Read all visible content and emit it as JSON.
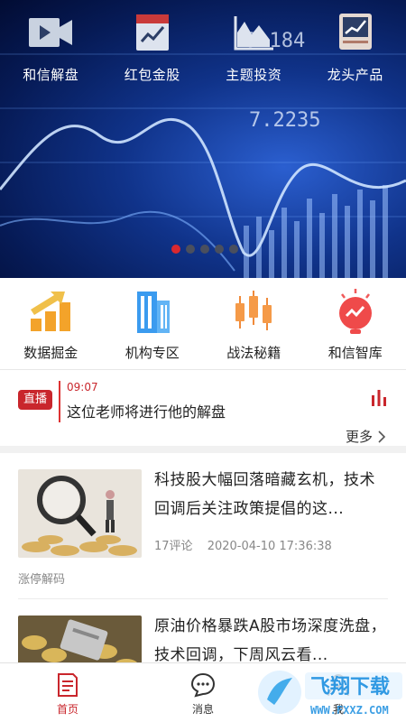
{
  "banner": {
    "quick_items": [
      {
        "label": "和信解盘",
        "icon": "video-icon"
      },
      {
        "label": "红包金股",
        "icon": "stock-chart-card-icon"
      },
      {
        "label": "主题投资",
        "icon": "area-chart-icon"
      },
      {
        "label": "龙头产品",
        "icon": "trend-board-icon"
      }
    ],
    "numbers": [
      "9.184",
      "7.2235"
    ],
    "carousel": {
      "count": 5,
      "active": 1
    }
  },
  "features": [
    {
      "label": "数据掘金",
      "icon": "bar-growth-icon"
    },
    {
      "label": "机构专区",
      "icon": "building-icon"
    },
    {
      "label": "战法秘籍",
      "icon": "candlestick-icon"
    },
    {
      "label": "和信智库",
      "icon": "bulb-chart-icon"
    }
  ],
  "live": {
    "tag": "直播",
    "time": "09:07",
    "text": "这位老师将进行他的解盘",
    "more_label": "更多"
  },
  "news": [
    {
      "title": "科技股大幅回落暗藏玄机，技术回调后关注政策提倡的这...",
      "comments": "17评论",
      "datetime": "2020-04-10 17:36:38",
      "tag": "涨停解码"
    },
    {
      "title": "原油价格暴跌A股市场深度洗盘，技术回调，下周风云看...",
      "comments": "",
      "datetime": "",
      "tag": ""
    }
  ],
  "tabbar": [
    {
      "label": "首页",
      "icon": "home-doc-icon",
      "active": true
    },
    {
      "label": "消息",
      "icon": "chat-icon",
      "active": false
    },
    {
      "label": "我",
      "icon": "user-icon",
      "active": false
    }
  ],
  "watermark": {
    "text": "飞翔下载",
    "url": "WWW.FXXZ.COM"
  }
}
